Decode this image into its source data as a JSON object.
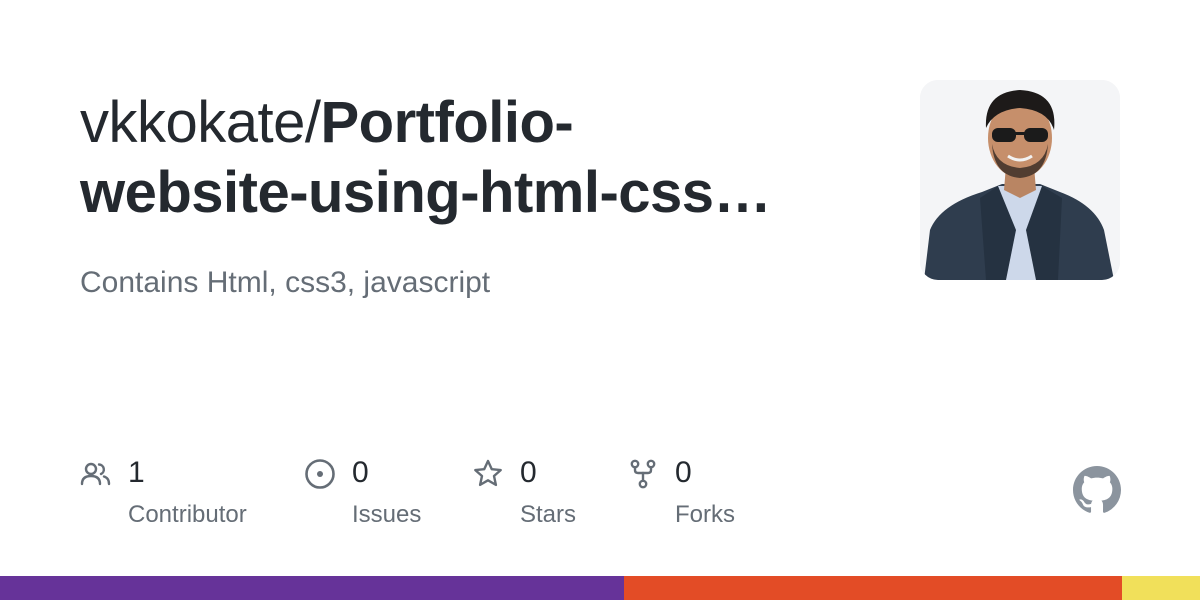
{
  "repo": {
    "owner_prefix": "vkkokate/",
    "name_line1": "Portfolio-",
    "name_line2": "website-using-html-css…",
    "description": "Contains Html, css3, javascript"
  },
  "stats": [
    {
      "icon": "people-icon",
      "value": "1",
      "label": "Contributor"
    },
    {
      "icon": "issue-icon",
      "value": "0",
      "label": "Issues"
    },
    {
      "icon": "star-icon",
      "value": "0",
      "label": "Stars"
    },
    {
      "icon": "fork-icon",
      "value": "0",
      "label": "Forks"
    }
  ],
  "language_bar": [
    {
      "color": "#663399",
      "share": 0.52
    },
    {
      "color": "#e34c26",
      "share": 0.415
    },
    {
      "color": "#f1e05a",
      "share": 0.065
    }
  ],
  "colors": {
    "title": "#24292f",
    "muted": "#656d76",
    "icon": "#656d76",
    "github_logo": "#8b949e"
  }
}
